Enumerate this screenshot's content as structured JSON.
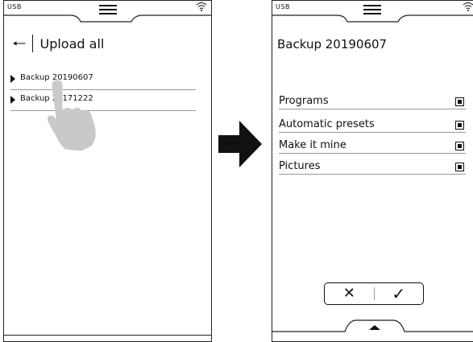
{
  "status_bar": {
    "usb_label": "USB"
  },
  "left_screen": {
    "title": "Upload all",
    "backups": [
      {
        "label": "Backup 20190607"
      },
      {
        "label": "Backup 20171222"
      }
    ]
  },
  "right_screen": {
    "title": "Backup 20190607",
    "options": [
      {
        "label": "Programs",
        "checked": true
      },
      {
        "label": "Automatic presets",
        "checked": true
      },
      {
        "label": "Make it mine",
        "checked": true
      },
      {
        "label": "Pictures",
        "checked": true
      }
    ]
  },
  "icons": {
    "menu": "menu-icon",
    "wifi": "wifi-icon",
    "back": "left-arrow-icon",
    "next": "right-arrow-icon",
    "cancel": "cross-icon",
    "confirm": "check-icon",
    "expand": "up-triangle-icon",
    "hand": "hand-pointer-icon"
  }
}
